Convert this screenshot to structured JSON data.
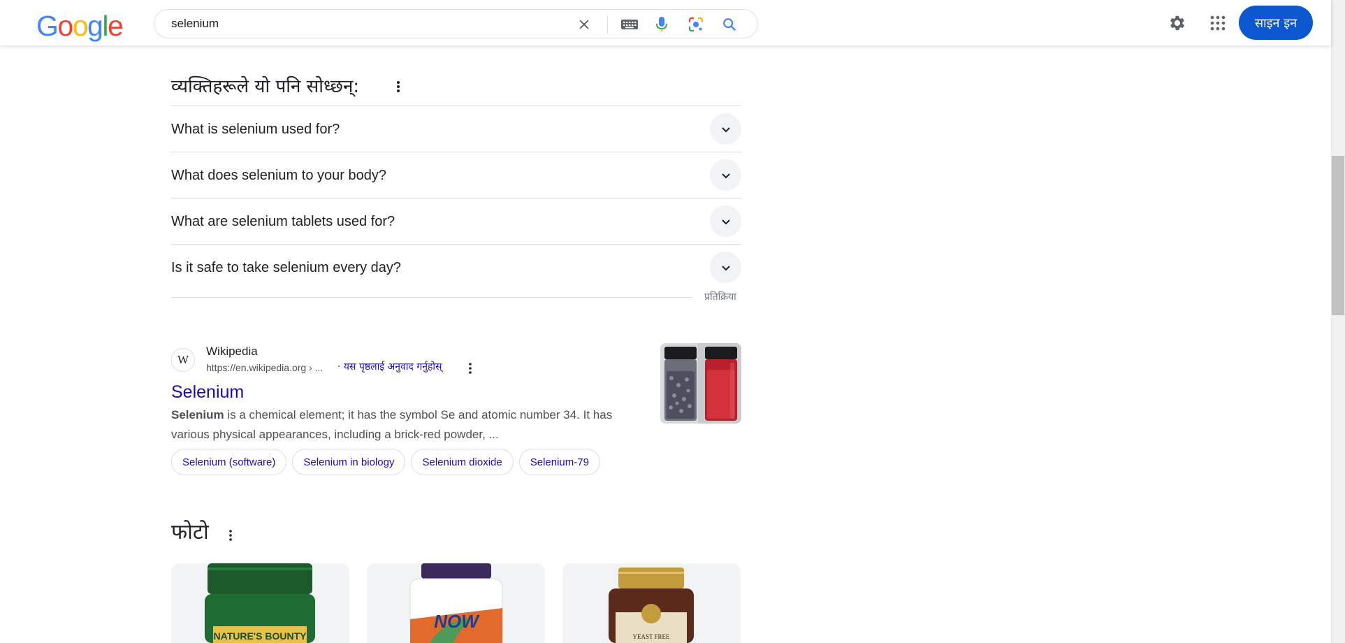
{
  "header": {
    "logo": "Google",
    "search": {
      "value": "selenium",
      "placeholder": ""
    },
    "icons": {
      "clear": "close-icon",
      "keyboard": "keyboard-icon",
      "voice": "microphone-icon",
      "lens": "camera-lens-icon",
      "search": "search-icon",
      "settings": "gear-icon",
      "apps": "apps-grid-icon"
    },
    "signin_label": "साइन इन"
  },
  "people_also_ask": {
    "title": "व्यक्तिहरूले यो पनि सोध्छन्:",
    "questions": [
      "What is selenium used for?",
      "What does selenium to your body?",
      "What are selenium tablets used for?",
      "Is it safe to take selenium every day?"
    ],
    "feedback": "प्रतिक्रिया"
  },
  "result": {
    "favicon": "W",
    "site": "Wikipedia",
    "url": "https://en.wikipedia.org › ...",
    "translate": "· यस पृष्ठलाई अनुवाद गर्नुहोस्",
    "title": "Selenium",
    "snippet_bold": "Selenium",
    "snippet_line1": " is a chemical element; it has the symbol Se and atomic number 34. It has",
    "snippet_line2": "various physical appearances, including a brick-red powder, ...",
    "chips": [
      "Selenium (software)",
      "Selenium in biology",
      "Selenium dioxide",
      "Selenium-79"
    ]
  },
  "photos": {
    "title": "फोटो",
    "items": [
      {
        "label": "NATURE'S BOUNTY",
        "cap": "#1e5a2e",
        "body": "#1f6b34"
      },
      {
        "label": "NOW",
        "cap": "#3c2a5c",
        "body": "#ffffff"
      },
      {
        "label": "YEAST FREE",
        "cap": "#b8862d",
        "body": "#5a2a1a"
      }
    ]
  },
  "colors": {
    "link": "#1a0dab",
    "signin_bg": "#0b57d0",
    "google_blue": "#4285f4",
    "google_red": "#ea4335",
    "google_yellow": "#fbbc05",
    "google_green": "#34a853"
  }
}
